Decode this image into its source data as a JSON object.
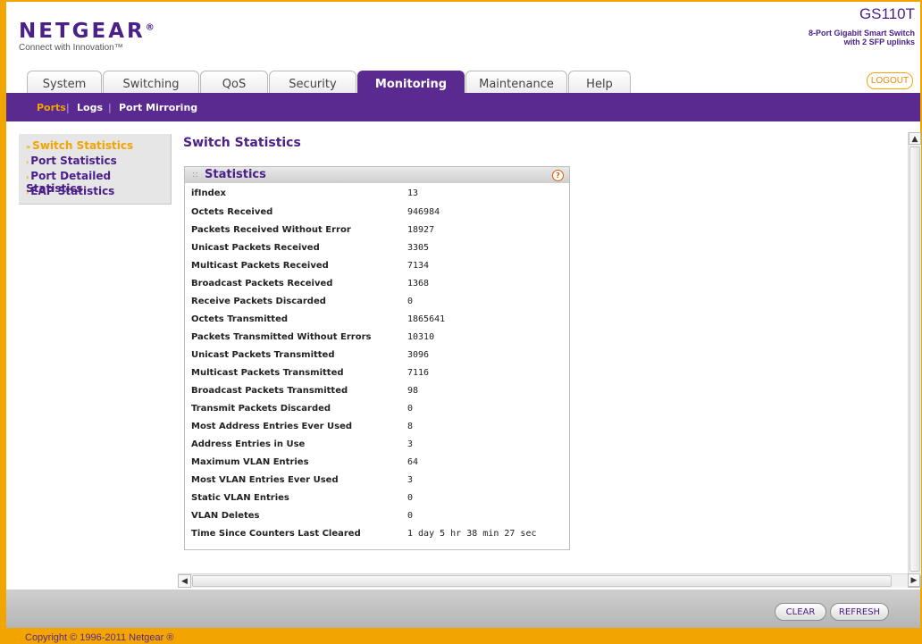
{
  "header": {
    "brand": "NETGEAR",
    "brand_mark": "®",
    "tagline": "Connect with Innovation™",
    "model": "GS110T",
    "model_desc_1": "8-Port Gigabit Smart Switch",
    "model_desc_2": "with 2 SFP uplinks",
    "logout_label": "LOGOUT"
  },
  "tabs": [
    {
      "label": "System"
    },
    {
      "label": "Switching"
    },
    {
      "label": "QoS"
    },
    {
      "label": "Security"
    },
    {
      "label": "Monitoring",
      "active": true
    },
    {
      "label": "Maintenance"
    },
    {
      "label": "Help"
    }
  ],
  "subnav": {
    "items": [
      {
        "label": "Ports",
        "active": true
      },
      {
        "label": "Logs"
      },
      {
        "label": "Port Mirroring"
      }
    ],
    "separator": "|"
  },
  "sidemenu": {
    "items": [
      {
        "label": "Switch Statistics",
        "active": true
      },
      {
        "label": "Port Statistics"
      },
      {
        "label": "Port Detailed Statistics"
      },
      {
        "label": "EAP Statistics"
      }
    ]
  },
  "main": {
    "title": "Switch Statistics",
    "panel_title": "Statistics",
    "rows": [
      {
        "label": "ifIndex",
        "value": "13"
      },
      {
        "label": "Octets Received",
        "value": "946984"
      },
      {
        "label": "Packets Received Without Error",
        "value": "18927"
      },
      {
        "label": "Unicast Packets Received",
        "value": "3305"
      },
      {
        "label": "Multicast Packets Received",
        "value": "7134"
      },
      {
        "label": "Broadcast Packets Received",
        "value": "1368"
      },
      {
        "label": "Receive Packets Discarded",
        "value": "0"
      },
      {
        "label": "Octets Transmitted",
        "value": "1865641"
      },
      {
        "label": "Packets Transmitted Without Errors",
        "value": "10310"
      },
      {
        "label": "Unicast Packets Transmitted",
        "value": "3096"
      },
      {
        "label": "Multicast Packets Transmitted",
        "value": "7116"
      },
      {
        "label": "Broadcast Packets Transmitted",
        "value": "98"
      },
      {
        "label": "Transmit Packets Discarded",
        "value": "0"
      },
      {
        "label": "Most Address Entries Ever Used",
        "value": "8"
      },
      {
        "label": "Address Entries in Use",
        "value": "3"
      },
      {
        "label": "Maximum VLAN Entries",
        "value": "64"
      },
      {
        "label": "Most VLAN Entries Ever Used",
        "value": "3"
      },
      {
        "label": "Static VLAN Entries",
        "value": "0"
      },
      {
        "label": "VLAN Deletes",
        "value": "0"
      },
      {
        "label": "Time Since Counters Last Cleared",
        "value": "1 day 5 hr 38 min 27 sec"
      }
    ]
  },
  "footer": {
    "clear_label": "CLEAR",
    "refresh_label": "REFRESH",
    "copyright": "Copyright © 1996-2011 Netgear ®"
  },
  "icons": {
    "help": "help-icon",
    "scroll_up": "scroll-up-arrow-icon",
    "scroll_down": "scroll-down-arrow-icon",
    "scroll_left": "scroll-left-arrow-icon",
    "scroll_right": "scroll-right-arrow-icon"
  },
  "colors": {
    "brand_purple": "#5a2a91",
    "accent_orange": "#f2a400"
  }
}
